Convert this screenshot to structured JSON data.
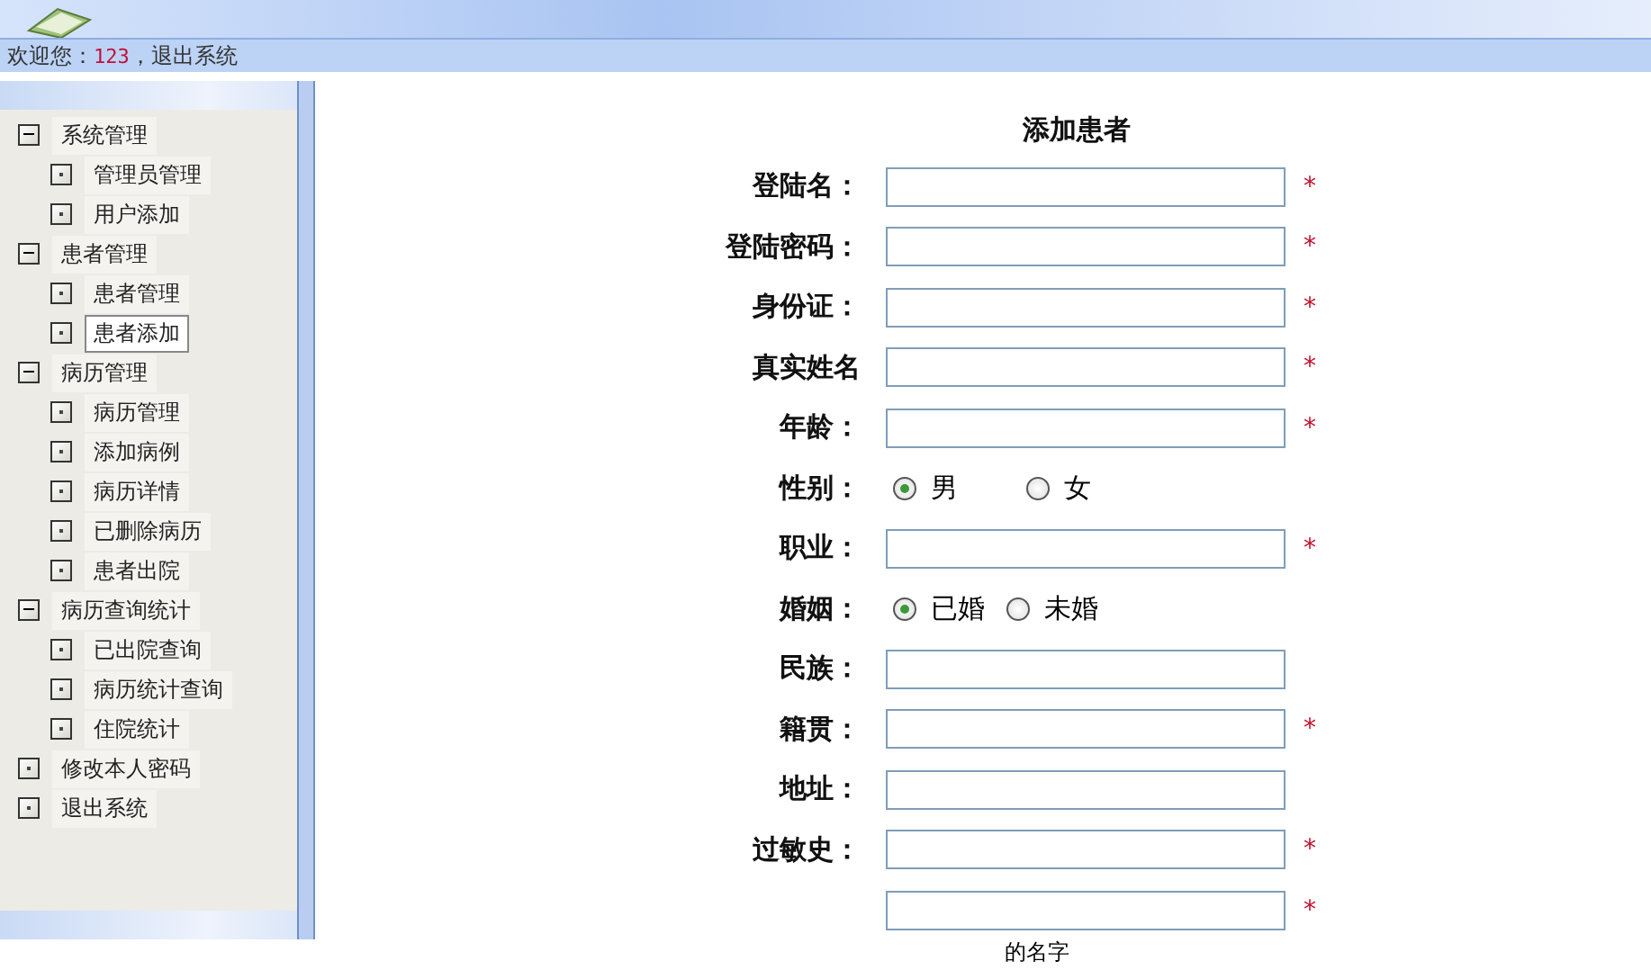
{
  "welcome": {
    "greeting": "欢迎您：",
    "user": "123",
    "logout": "，退出系统"
  },
  "sidebar": {
    "items": [
      {
        "label": "系统管理",
        "expanded": true,
        "selected": false,
        "children": [
          {
            "label": "管理员管理",
            "selected": false
          },
          {
            "label": "用户添加",
            "selected": false
          }
        ]
      },
      {
        "label": "患者管理",
        "expanded": true,
        "selected": false,
        "children": [
          {
            "label": "患者管理",
            "selected": false
          },
          {
            "label": "患者添加",
            "selected": true
          }
        ]
      },
      {
        "label": "病历管理",
        "expanded": true,
        "selected": false,
        "children": [
          {
            "label": "病历管理",
            "selected": false
          },
          {
            "label": "添加病例",
            "selected": false
          },
          {
            "label": "病历详情",
            "selected": false
          },
          {
            "label": "已删除病历",
            "selected": false
          },
          {
            "label": "患者出院",
            "selected": false
          }
        ]
      },
      {
        "label": "病历查询统计",
        "expanded": true,
        "selected": false,
        "children": [
          {
            "label": "已出院查询",
            "selected": false
          },
          {
            "label": "病历统计查询",
            "selected": false
          },
          {
            "label": "住院统计",
            "selected": false
          }
        ]
      },
      {
        "label": "修改本人密码",
        "selected": false
      },
      {
        "label": "退出系统",
        "selected": false
      }
    ]
  },
  "form": {
    "title": "添加患者",
    "rows": [
      {
        "kind": "text",
        "label": "登陆名：",
        "mark": "*"
      },
      {
        "kind": "text",
        "label": "登陆密码：",
        "mark": "*"
      },
      {
        "kind": "text",
        "label": "身份证：",
        "mark": "*"
      },
      {
        "kind": "text",
        "label": "真实姓名",
        "mark": "*"
      },
      {
        "kind": "text",
        "label": "年龄：",
        "mark": "*"
      },
      {
        "kind": "radio",
        "label": "性别：",
        "options": [
          {
            "label": "男",
            "selected": true
          },
          {
            "label": "女",
            "selected": false
          }
        ]
      },
      {
        "kind": "text",
        "label": "职业：",
        "mark": "*"
      },
      {
        "kind": "radio",
        "label": "婚姻：",
        "options": [
          {
            "label": "已婚",
            "selected": true
          },
          {
            "label": "未婚",
            "selected": false
          }
        ]
      },
      {
        "kind": "text",
        "label": "民族："
      },
      {
        "kind": "text",
        "label": "籍贯：",
        "mark": "*"
      },
      {
        "kind": "text",
        "label": "地址："
      },
      {
        "kind": "text",
        "label": "过敏史：",
        "mark": "*"
      },
      {
        "kind": "text",
        "mark": "*"
      }
    ],
    "note": "的名字"
  }
}
